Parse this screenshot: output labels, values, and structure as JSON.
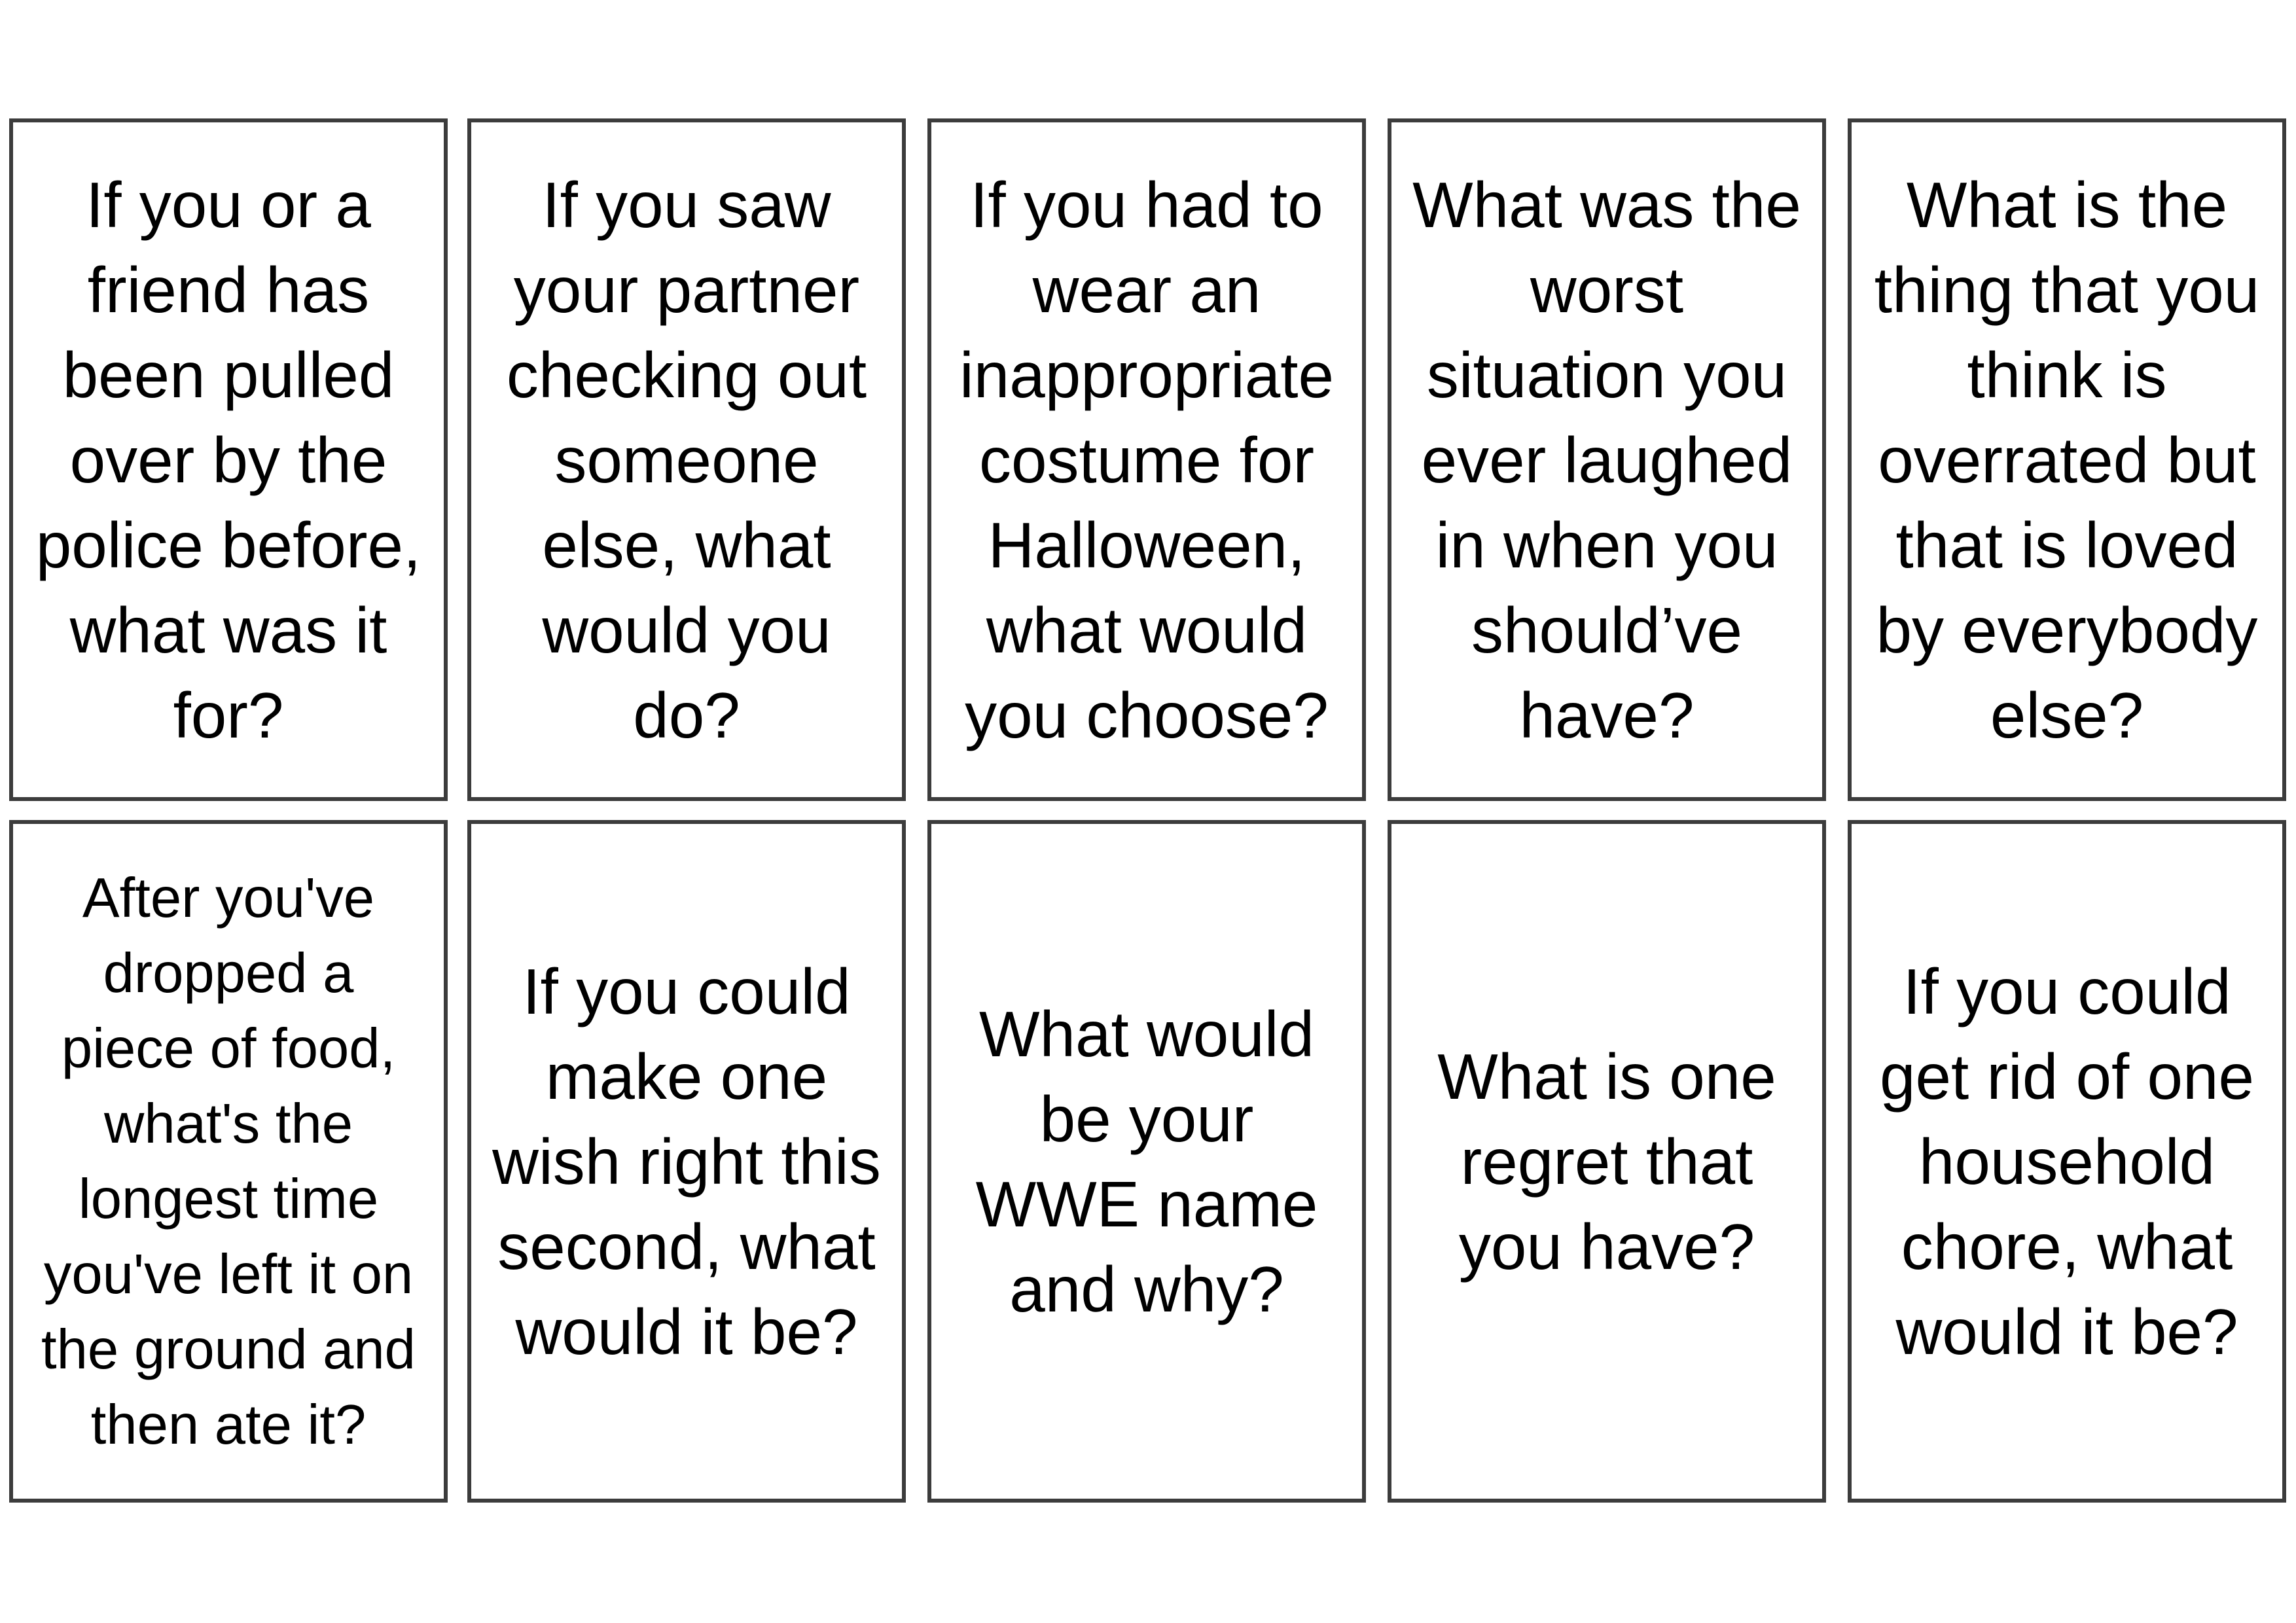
{
  "cards": [
    "If you or a friend has been pulled over by the police before, what was it for?",
    "If you saw your partner checking out someone else, what would you do?",
    "If you had to wear an inappropriate costume for Halloween, what would you choose?",
    "What was the worst situation you ever laughed in when you should’ve have?",
    "What is the thing that you think is overrated but that is loved by everybody else?",
    "After you've dropped a piece of food, what's the longest time you've left it on the ground and then ate it?",
    "If you could make one wish right this second, what would it be?",
    "What would be your WWE name and why?",
    "What is one regret that you have?",
    "If you could get rid of one household chore, what would it be?"
  ]
}
